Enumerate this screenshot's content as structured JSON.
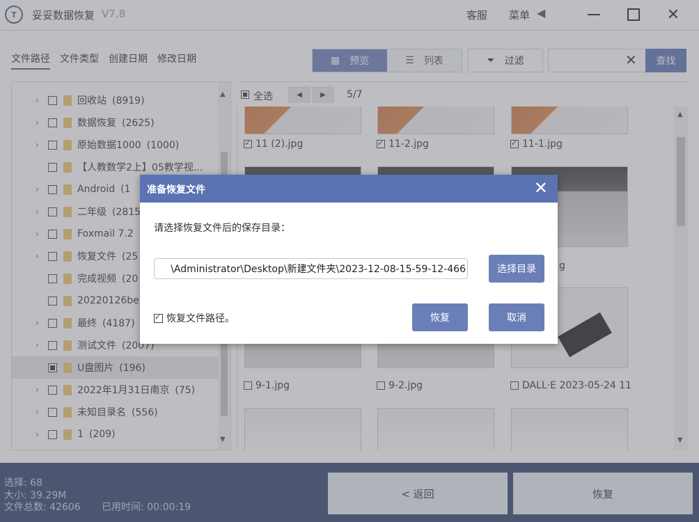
{
  "app": {
    "logo": "T",
    "title": "妥妥数据恢复",
    "version": "V7.8"
  },
  "titlebar": {
    "service": "客服",
    "menu": "菜单",
    "menu_arrow": "◀",
    "close": "✕"
  },
  "filter_tabs": [
    "文件路径",
    "文件类型",
    "创建日期",
    "修改日期"
  ],
  "view": {
    "preview": "预览",
    "list": "列表",
    "filter": "过滤",
    "search_placeholder": "",
    "search_clear": "✕",
    "search": "查找"
  },
  "tree": [
    {
      "label": "回收站",
      "count": "(8919)",
      "chevron": true,
      "check": "empty"
    },
    {
      "label": "数据恢复",
      "count": "(2625)",
      "chevron": true,
      "check": "empty"
    },
    {
      "label": "原始数据1000",
      "count": "(1000)",
      "chevron": true,
      "check": "empty"
    },
    {
      "label": "【人教数学2上】05教学视...",
      "count": "",
      "chevron": false,
      "check": "empty"
    },
    {
      "label": "Android",
      "count": "(1",
      "chevron": true,
      "check": "empty"
    },
    {
      "label": "二年级",
      "count": "(2815",
      "chevron": true,
      "check": "empty"
    },
    {
      "label": "Foxmail 7.2",
      "count": "",
      "chevron": true,
      "check": "empty"
    },
    {
      "label": "恢复文件",
      "count": "(25",
      "chevron": true,
      "check": "empty"
    },
    {
      "label": "完成视频",
      "count": "(20",
      "chevron": false,
      "check": "empty"
    },
    {
      "label": "20220126be",
      "count": "",
      "chevron": false,
      "check": "empty"
    },
    {
      "label": "最终",
      "count": "(4187)",
      "chevron": true,
      "check": "empty"
    },
    {
      "label": "测试文件",
      "count": "(2007)",
      "chevron": true,
      "check": "empty"
    },
    {
      "label": "U盘图片",
      "count": "(196)",
      "chevron": false,
      "check": "partial",
      "selected": true
    },
    {
      "label": "2022年1月31日南京",
      "count": "(75)",
      "chevron": true,
      "check": "empty"
    },
    {
      "label": "未知目录名",
      "count": "(556)",
      "chevron": true,
      "check": "empty"
    },
    {
      "label": "1",
      "count": "(209)",
      "chevron": true,
      "check": "empty"
    }
  ],
  "grid": {
    "select_all": "全选",
    "prev": "◀",
    "next": "▶",
    "page": "5/7",
    "row1": [
      "11 (2).jpg",
      "11-2.jpg",
      "11-1.jpg"
    ],
    "row2_partial": "g",
    "row3": [
      "9-1.jpg",
      "9-2.jpg",
      "DALL·E 2023-05-24 11"
    ]
  },
  "stats": {
    "selected": "选择: 68",
    "size": "大小: 39.29M",
    "total": "文件总数: 42606",
    "elapsed": "已用时间: 00:00:19"
  },
  "bottom": {
    "back": "< 返回",
    "recover": "恢复"
  },
  "dialog": {
    "title": "准备恢复文件",
    "close": "✕",
    "prompt": "请选择恢复文件后的保存目录：",
    "path": "\\Administrator\\Desktop\\新建文件夹\\2023-12-08-15-59-12-466",
    "choose_dir": "选择目录",
    "keep_path": "恢复文件路径。",
    "recover": "恢复",
    "cancel": "取消"
  },
  "colors": {
    "accent": "#5b73b3",
    "bottombar": "#31426b",
    "folder": "#e9c76a"
  }
}
